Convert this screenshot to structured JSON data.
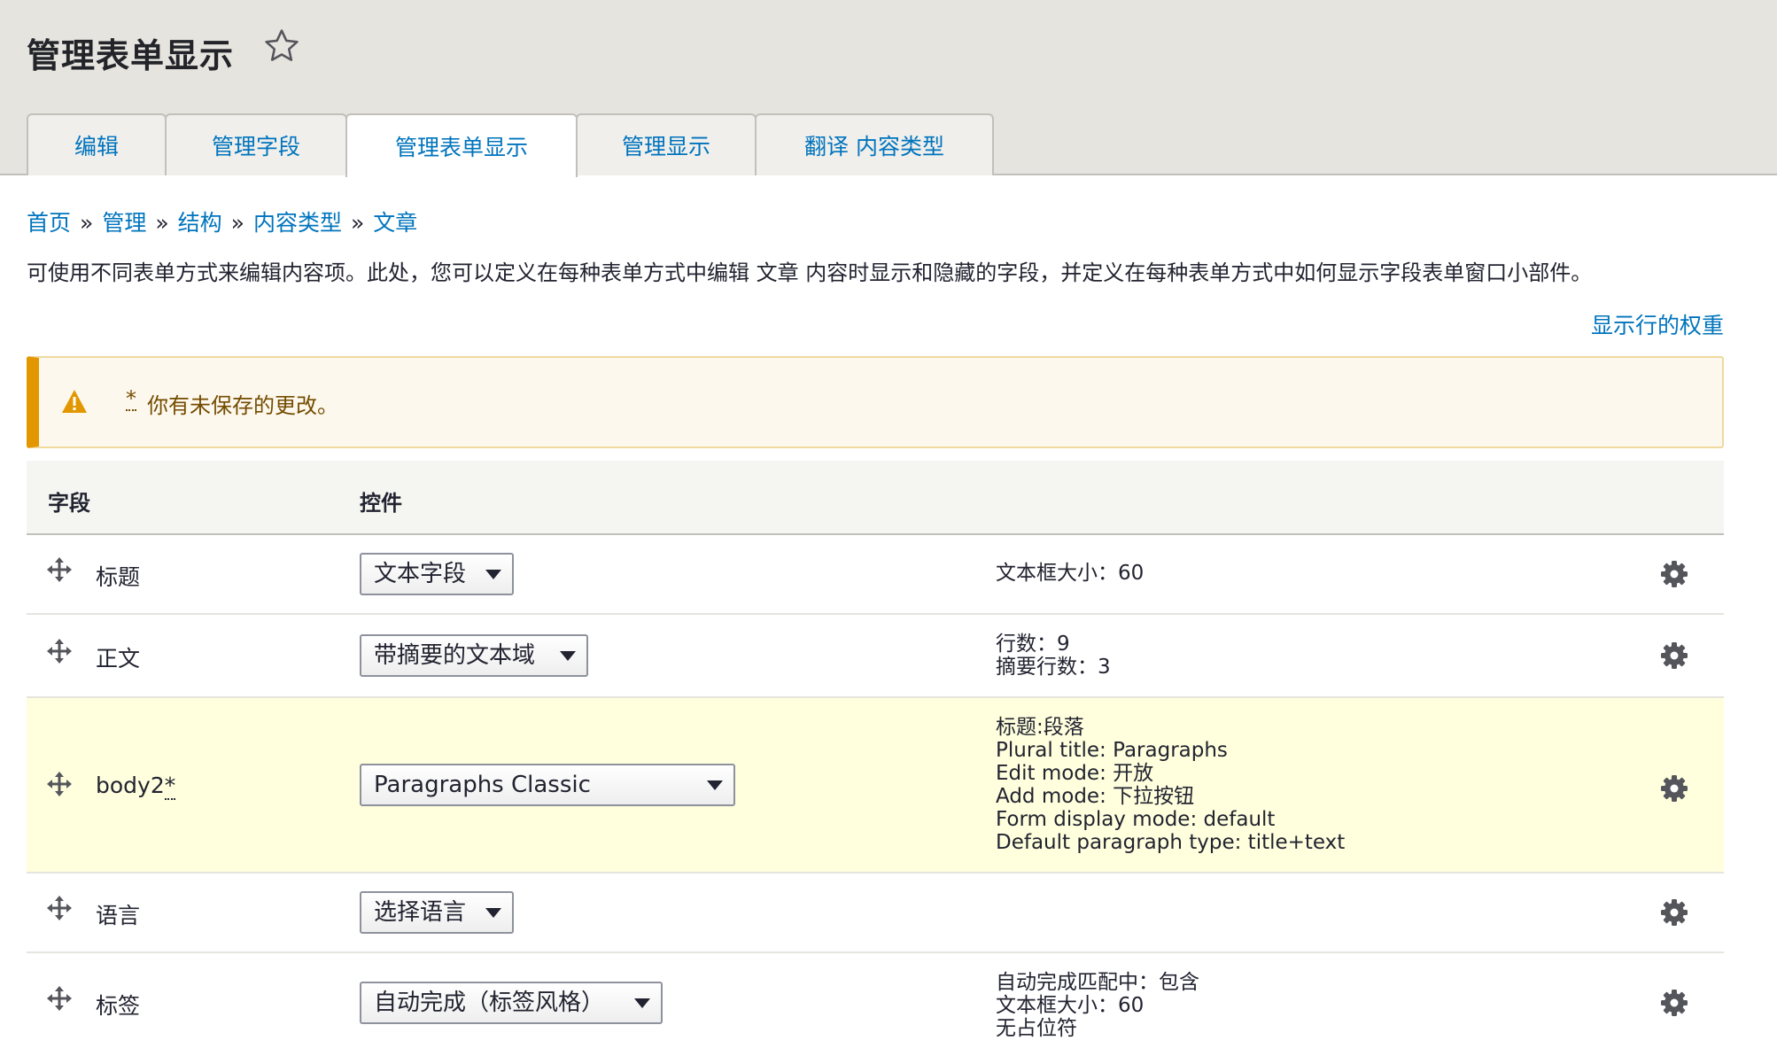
{
  "page": {
    "title": "管理表单显示"
  },
  "tabs": [
    {
      "label": "编辑"
    },
    {
      "label": "管理字段"
    },
    {
      "label": "管理表单显示"
    },
    {
      "label": "管理显示"
    },
    {
      "label": "翻译 内容类型"
    }
  ],
  "breadcrumb": [
    "首页",
    "管理",
    "结构",
    "内容类型",
    "文章"
  ],
  "breadcrumb_separator": "»",
  "description": "可使用不同表单方式来编辑内容项。此处，您可以定义在每种表单方式中编辑 文章 内容时显示和隐藏的字段，并定义在每种表单方式中如何显示字段表单窗口小部件。",
  "weights_link": "显示行的权重",
  "warning": {
    "star": "*",
    "text": "你有未保存的更改。",
    "color": "#e29700"
  },
  "table": {
    "headers": {
      "field": "字段",
      "widget": "控件"
    },
    "rows": [
      {
        "label": "标题",
        "changed": "",
        "widget": "文本字段",
        "summary": "文本框大小：60"
      },
      {
        "label": "正文",
        "changed": "",
        "widget": "带摘要的文本域",
        "summary": "行数：9\n摘要行数：3"
      },
      {
        "label": "body2",
        "changed": "*",
        "widget": "Paragraphs Classic",
        "summary": "标题:段落\nPlural title: Paragraphs\nEdit mode: 开放\nAdd mode: 下拉按钮\nForm display mode: default\nDefault paragraph type: title+text"
      },
      {
        "label": "语言",
        "changed": "",
        "widget": "选择语言",
        "summary": ""
      },
      {
        "label": "标签",
        "changed": "",
        "widget": "自动完成（标签风格）",
        "summary": "自动完成匹配中：包含\n文本框大小：60\n无占位符"
      }
    ]
  },
  "colors": {
    "link": "#0074bd",
    "changed_row": "#ffffdd",
    "header_bg": "#e6e4df"
  },
  "icons": {
    "favorite": "star-icon",
    "warning": "warning-icon",
    "drag": "drag-handle-icon",
    "settings": "gear-icon"
  }
}
